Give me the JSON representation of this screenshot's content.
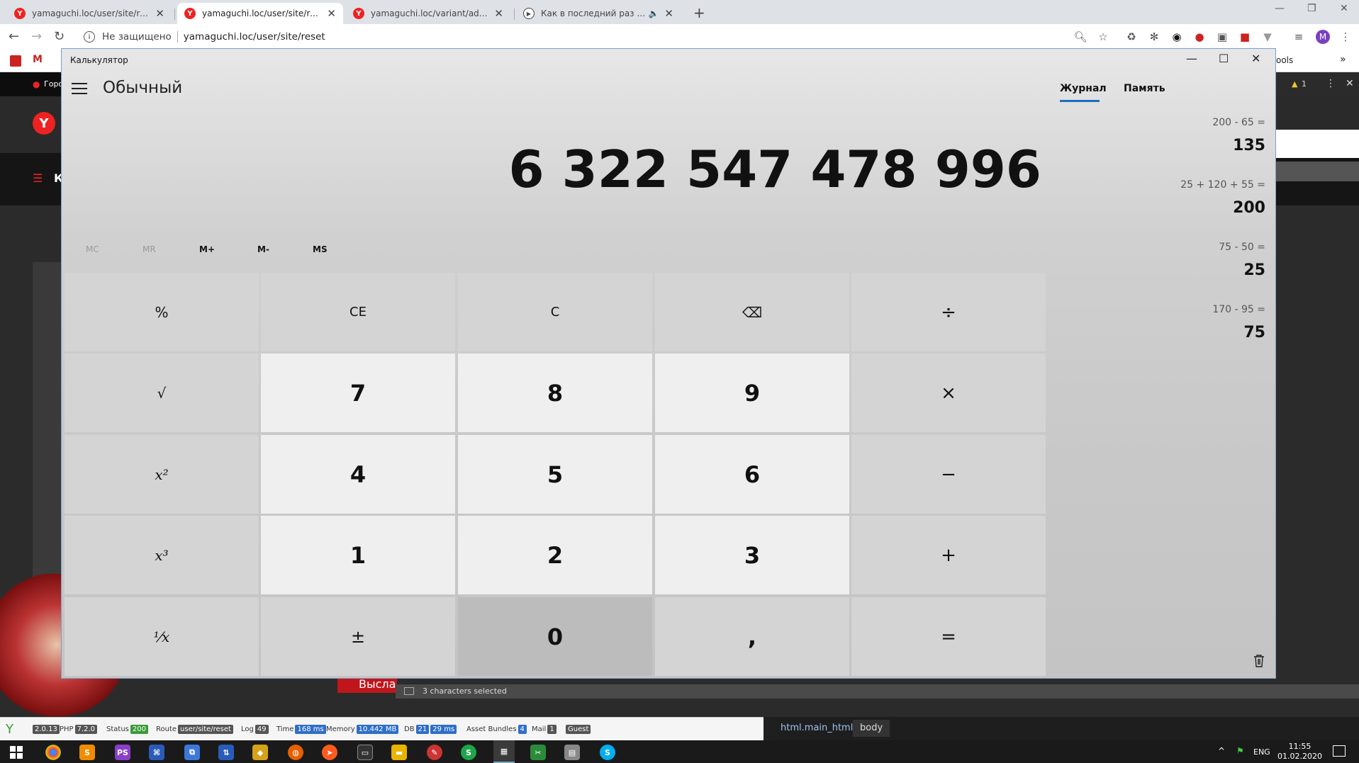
{
  "browser": {
    "tabs": [
      {
        "title": "yamaguchi.loc/user/site/registrat",
        "icon": "yandex-icon",
        "active": false
      },
      {
        "title": "yamaguchi.loc/user/site/reset",
        "icon": "yandex-icon",
        "active": true
      },
      {
        "title": "yamaguchi.loc/variant/admin/inc",
        "icon": "yandex-icon",
        "active": false
      },
      {
        "title": "Как в последний раз — Пор",
        "icon": "youtube-icon",
        "active": false
      }
    ],
    "security_label": "Не защищено",
    "url": "yamaguchi.loc/user/site/reset",
    "bookmark_partial": "ools",
    "warning_count": "1",
    "profile_initial": "M"
  },
  "page_behind": {
    "city_partial": "Горо",
    "nav_partial": "К",
    "submit_partial": "Высла"
  },
  "calculator": {
    "window_title": "Калькулятор",
    "mode": "Обычный",
    "display": "6 322 547 478 996",
    "memory": [
      "MC",
      "MR",
      "M+",
      "M-",
      "MS"
    ],
    "keys": [
      [
        "%",
        "CE",
        "C",
        "⌫",
        "÷"
      ],
      [
        "√",
        "7",
        "8",
        "9",
        "×"
      ],
      [
        "x²",
        "4",
        "5",
        "6",
        "−"
      ],
      [
        "x³",
        "1",
        "2",
        "3",
        "+"
      ],
      [
        "¹⁄x",
        "±",
        "0",
        ",",
        "="
      ]
    ],
    "tabs": {
      "history": "Журнал",
      "memory": "Память"
    },
    "history": [
      {
        "expr": "200  -  65 =",
        "result": "135"
      },
      {
        "expr": "25  +  120  +  55 =",
        "result": "200"
      },
      {
        "expr": "75  -  50 =",
        "result": "25"
      },
      {
        "expr": "170  -  95 =",
        "result": "75"
      }
    ]
  },
  "ide": {
    "status_text": "3 characters selected",
    "breadcrumb": [
      "html.main_html",
      "body"
    ]
  },
  "devbar": {
    "yii_version": "2.0.13",
    "php_label": "PHP",
    "php_version": "7.2.0",
    "status_label": "Status",
    "status_value": "200",
    "route_label": "Route",
    "route_value": "user/site/reset",
    "log_label": "Log",
    "log_value": "49",
    "time_label": "Time",
    "time_value": "168 ms",
    "memory_label": "Memory",
    "memory_value": "10.442 MB",
    "db_label": "DB",
    "db_count": "21",
    "db_time": "29 ms",
    "bundles_label": "Asset Bundles",
    "bundles_value": "4",
    "mail_label": "Mail",
    "mail_value": "1",
    "user_value": "Guest"
  },
  "taskbar": {
    "lang": "ENG",
    "time": "11:55",
    "date": "01.02.2020"
  },
  "colors": {
    "accent": "#1a6fc2",
    "yandex_red": "#e22222"
  }
}
